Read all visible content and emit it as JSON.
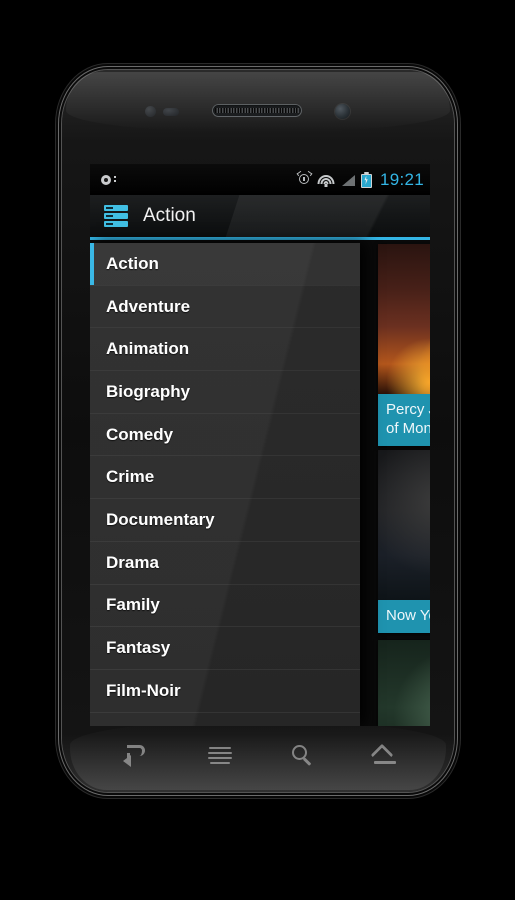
{
  "device": {
    "name": "android-phone-nexus-s",
    "hardware": {
      "proximity_sensor": "proximity-sensor",
      "light_sensor": "light-sensor",
      "earpiece": "earpiece-speaker",
      "front_camera": "front-camera"
    }
  },
  "status_bar": {
    "notification_icon": "notification-dot-icon",
    "alarm_icon": "alarm-clock-icon",
    "wifi_icon": "wifi-icon",
    "signal_icon": "cell-signal-icon",
    "battery_icon": "battery-charging-icon",
    "time": "19:21",
    "time_color": "#33b5e5"
  },
  "action_bar": {
    "drawer_icon": "drawer-list-icon",
    "title": "Action",
    "accent_color": "#33b5e5",
    "underline_color": "#33b5e5"
  },
  "drawer": {
    "selected_index": 0,
    "items": [
      {
        "label": "Action"
      },
      {
        "label": "Adventure"
      },
      {
        "label": "Animation"
      },
      {
        "label": "Biography"
      },
      {
        "label": "Comedy"
      },
      {
        "label": "Crime"
      },
      {
        "label": "Documentary"
      },
      {
        "label": "Drama"
      },
      {
        "label": "Family"
      },
      {
        "label": "Fantasy"
      },
      {
        "label": "Film-Noir"
      }
    ]
  },
  "content": {
    "cards": [
      {
        "caption": "Percy Jackson: Sea\nof Monsters",
        "caption_visible": "Per\nof M",
        "poster": "movie-poster-fire"
      },
      {
        "caption": "Now You See Me",
        "caption_visible": "Now",
        "poster": "movie-poster-dark"
      },
      {
        "caption": "",
        "caption_visible": "",
        "poster": "movie-poster-green"
      }
    ],
    "caption_bg": "#1f93af"
  },
  "nav_bar": {
    "buttons": [
      {
        "name": "back-button",
        "icon": "back-arrow-icon"
      },
      {
        "name": "menu-button",
        "icon": "menu-lines-icon"
      },
      {
        "name": "search-button",
        "icon": "search-magnifier-icon"
      },
      {
        "name": "home-button",
        "icon": "home-icon"
      }
    ]
  }
}
